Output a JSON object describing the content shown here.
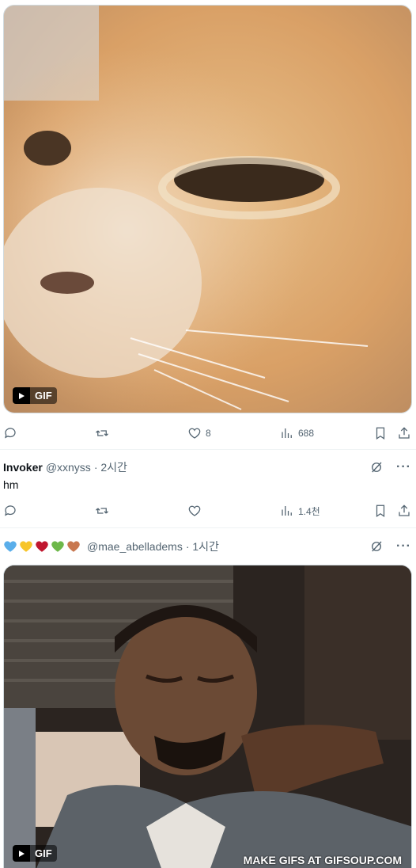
{
  "post1": {
    "gif_label": "GIF",
    "actions": {
      "replies": "",
      "retweets": "",
      "likes": "8",
      "views": "688"
    }
  },
  "tweet2": {
    "name": "Invoker",
    "handle": "@xxnyss",
    "time": "· 2시간",
    "text": "hm",
    "actions": {
      "replies": "",
      "retweets": "",
      "likes": "",
      "views": "1.4천"
    }
  },
  "tweet3": {
    "heart_colors": [
      "#5aaeea",
      "#f7c52b",
      "#c0172f",
      "#6db84a",
      "#c87850"
    ],
    "handle": "@mae_abelladems",
    "time": "· 1시간",
    "gif_label": "GIF",
    "watermark": "MAKE GIFS AT GIFSOUP.COM"
  },
  "icons": {
    "reply": "reply-icon",
    "retweet": "retweet-icon",
    "like": "heart-icon",
    "views": "views-icon",
    "bookmark": "bookmark-icon",
    "share": "share-icon",
    "grok": "grok-icon",
    "more": "more-icon",
    "play": "play-icon"
  }
}
